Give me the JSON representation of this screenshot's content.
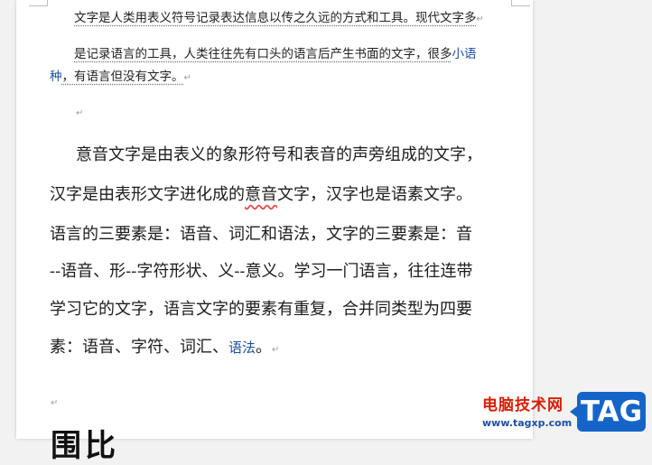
{
  "doc": {
    "para1": {
      "line1": "文字是人类用表义符号记录表达信息以传之久远的方式和工具。现代文字多"
    },
    "para2": {
      "line1_text": "是记录语言的工具，人类往往先有口头的语言后产生书面的文字，很多",
      "line1_link": "小语",
      "line2_link": "种",
      "line2_text": "，有语言但没有文字。"
    },
    "para3": {
      "line1": "意音文字是由表义的象形符号和表音的声旁组成的文字，",
      "line2_a": "汉字是由表形文字进化成的",
      "line2_wavy": "意音",
      "line2_b": "文字，汉字也是语素文字。",
      "line3": "语言的三要素是：语音、词汇和语法，文字的三要素是：音",
      "line4": "--语音、形--字符形状、义--意义。学习一门语言，往往连带",
      "line5": "学习它的文字，语言文字的要素有重复，合并同类型为四要",
      "line6_a": "素：语音、字符、词汇、",
      "line6_link": "语法",
      "line6_b": "。"
    },
    "paragraph_mark": "↵",
    "return_mark": "↵",
    "heading_partial": "围比"
  },
  "watermark": {
    "site_name": "电脑技术网",
    "url": "www.tagxp.com",
    "tag": "TAG"
  },
  "colors": {
    "link": "#1a4fa0",
    "watermark_red": "#d81e06",
    "watermark_blue": "#1565c8"
  }
}
